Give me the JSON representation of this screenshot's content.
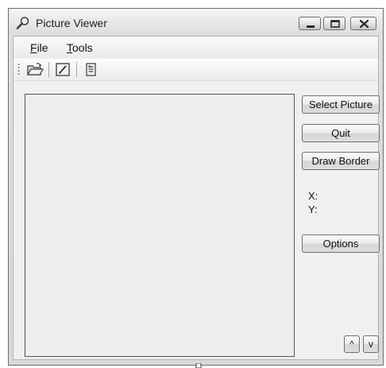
{
  "window": {
    "title": "Picture Viewer",
    "controls": [
      "minimize",
      "maximize",
      "close"
    ]
  },
  "menu": {
    "items": [
      {
        "label": "File",
        "mnemonic": "F"
      },
      {
        "label": "Tools",
        "mnemonic": "T"
      }
    ]
  },
  "toolbar": {
    "icons": [
      "open-folder-icon",
      "draw-border-icon",
      "options-icon"
    ]
  },
  "buttons": {
    "select_picture": "Select Picture",
    "quit": "Quit",
    "draw_border": "Draw Border",
    "options": "Options",
    "up": "^",
    "down": "v"
  },
  "coords": {
    "x_label": "X:",
    "y_label": "Y:"
  }
}
